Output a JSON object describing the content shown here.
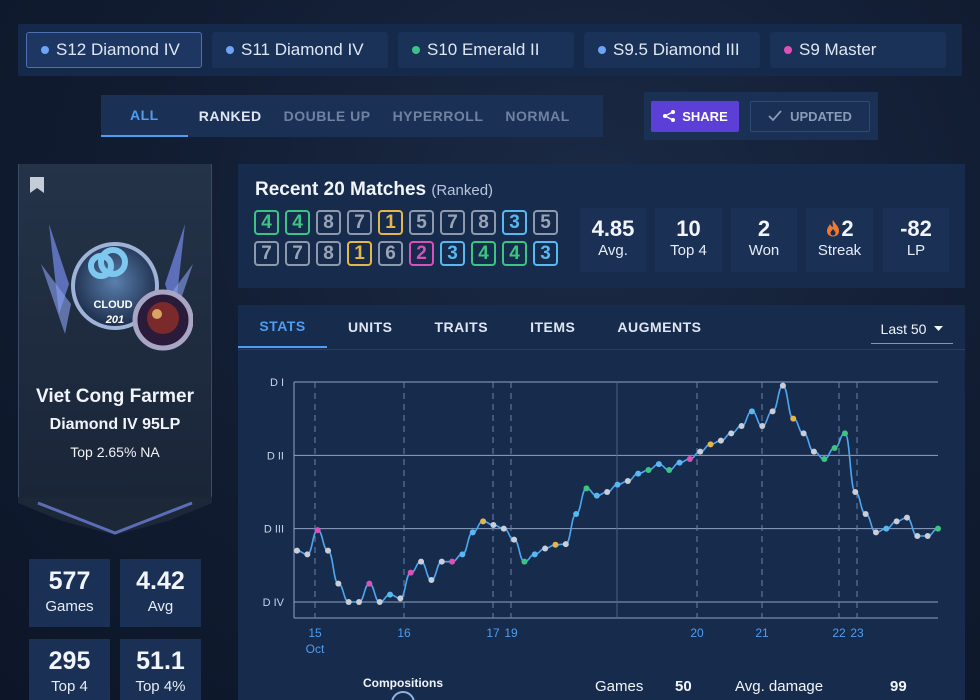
{
  "seasons": [
    {
      "label": "S12 Diamond IV",
      "color": "#6fa3f7",
      "active": true
    },
    {
      "label": "S11 Diamond IV",
      "color": "#6fa3f7"
    },
    {
      "label": "S10 Emerald II",
      "color": "#3ac28a"
    },
    {
      "label": "S9.5 Diamond III",
      "color": "#6fa3f7"
    },
    {
      "label": "S9 Master",
      "color": "#e04fb8"
    }
  ],
  "modes": [
    "ALL",
    "RANKED",
    "DOUBLE UP",
    "HYPERROLL",
    "NORMAL"
  ],
  "actions": {
    "share": "SHARE",
    "updated": "UPDATED"
  },
  "profile": {
    "name": "Viet Cong Farmer",
    "rank": "Diamond IV 95LP",
    "top": "Top 2.65% NA",
    "emblem_text": [
      "CLOUD",
      "201"
    ]
  },
  "summary": [
    {
      "value": "577",
      "label": "Games"
    },
    {
      "value": "4.42",
      "label": "Avg"
    },
    {
      "value": "295",
      "label": "Top 4"
    },
    {
      "value": "51.1",
      "label": "Top 4%"
    }
  ],
  "recent": {
    "title": "Recent 20 Matches",
    "subtitle": "(Ranked)",
    "placements": [
      4,
      4,
      8,
      7,
      1,
      5,
      7,
      8,
      3,
      5,
      7,
      7,
      8,
      1,
      6,
      2,
      3,
      4,
      4,
      3
    ],
    "stats": [
      {
        "value": "4.85",
        "label": "Avg."
      },
      {
        "value": "10",
        "label": "Top 4"
      },
      {
        "value": "2",
        "label": "Won"
      },
      {
        "value": "2",
        "label": "Streak"
      },
      {
        "value": "-82",
        "label": "LP"
      }
    ]
  },
  "stats_tabs": [
    "STATS",
    "UNITS",
    "TRAITS",
    "ITEMS",
    "AUGMENTS"
  ],
  "range": "Last 50",
  "chart_data": {
    "type": "line",
    "ylabels": [
      "D I",
      "D II",
      "D III",
      "D IV"
    ],
    "xticks": [
      "15",
      "16",
      "17",
      "19",
      "20",
      "21",
      "22",
      "23"
    ],
    "xsub": "Oct",
    "values": [
      2.7,
      2.65,
      2.98,
      2.7,
      2.25,
      2.0,
      2.0,
      2.25,
      2.0,
      2.1,
      2.05,
      2.4,
      2.55,
      2.3,
      2.55,
      2.55,
      2.65,
      2.95,
      3.1,
      3.05,
      3.0,
      2.85,
      2.55,
      2.65,
      2.73,
      2.78,
      2.79,
      3.2,
      3.55,
      3.45,
      3.5,
      3.6,
      3.65,
      3.75,
      3.8,
      3.88,
      3.8,
      3.9,
      3.95,
      4.05,
      4.15,
      4.2,
      4.3,
      4.4,
      4.6,
      4.4,
      4.6,
      4.95,
      4.5,
      4.3,
      4.05,
      3.95,
      4.1,
      4.3,
      3.5,
      3.2,
      2.95,
      3.0,
      3.1,
      3.15,
      2.9,
      2.9,
      3.0
    ],
    "colors": [
      "#c9ced8",
      "#c9ced8",
      "#e04fb8",
      "#c9ced8",
      "#c9ced8",
      "#c9ced8",
      "#c9ced8",
      "#e04fb8",
      "#c9ced8",
      "#58b8ef",
      "#c9ced8",
      "#e04fb8",
      "#c9ced8",
      "#c9ced8",
      "#c9ced8",
      "#e04fb8",
      "#58b8ef",
      "#58b8ef",
      "#e5b64a",
      "#c9ced8",
      "#c9ced8",
      "#c9ced8",
      "#3cc483",
      "#58b8ef",
      "#c9ced8",
      "#e5b64a",
      "#c9ced8",
      "#58b8ef",
      "#3cc483",
      "#58b8ef",
      "#c9ced8",
      "#58b8ef",
      "#c9ced8",
      "#58b8ef",
      "#3cc483",
      "#58b8ef",
      "#3cc483",
      "#58b8ef",
      "#e04fb8",
      "#c9ced8",
      "#e5b64a",
      "#c9ced8",
      "#c9ced8",
      "#c9ced8",
      "#58b8ef",
      "#c9ced8",
      "#c9ced8",
      "#c9ced8",
      "#e5b64a",
      "#c9ced8",
      "#c9ced8",
      "#3cc483",
      "#3cc483",
      "#3cc483",
      "#c9ced8",
      "#c9ced8",
      "#c9ced8",
      "#58b8ef",
      "#c9ced8",
      "#c9ced8",
      "#c9ced8",
      "#c9ced8",
      "#3cc483"
    ]
  },
  "footer": {
    "compositions": "Compositions",
    "games_label": "Games",
    "games_value": "50",
    "dmg_label": "Avg. damage",
    "dmg_value": "99"
  }
}
